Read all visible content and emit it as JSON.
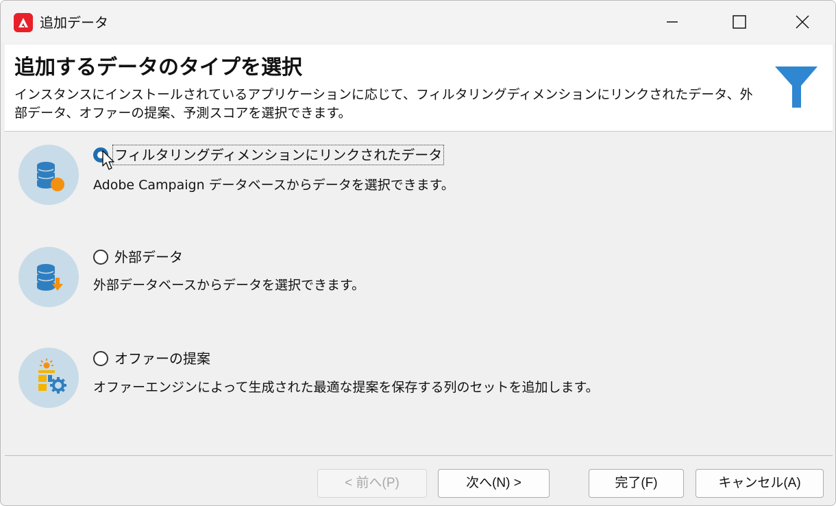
{
  "window": {
    "title": "追加データ"
  },
  "header": {
    "title": "追加するデータのタイプを選択",
    "description": "インスタンスにインストールされているアプリケーションに応じて、フィルタリングディメンションにリンクされたデータ、外部データ、オファーの提案、予測スコアを選択できます。"
  },
  "options": [
    {
      "label": "フィルタリングディメンションにリンクされたデータ",
      "description": "Adobe Campaign データベースからデータを選択できます。",
      "selected": true,
      "icon": "database-linked-icon"
    },
    {
      "label": "外部データ",
      "description": "外部データベースからデータを選択できます。",
      "selected": false,
      "icon": "database-download-icon"
    },
    {
      "label": "オファーの提案",
      "description": "オファーエンジンによって生成された最適な提案を保存する列のセットを追加します。",
      "selected": false,
      "icon": "offer-gear-icon"
    }
  ],
  "buttons": {
    "prev": "< 前へ(P)",
    "next": "次へ(N) >",
    "finish": "完了(F)",
    "cancel": "キャンセル(A)"
  },
  "colors": {
    "accent": "#1f6fb0",
    "icon_blue": "#2f7fc0",
    "icon_orange": "#f29111",
    "icon_bg": "#c8dbe8",
    "funnel": "#2f86d1",
    "brand_red": "#e8202a"
  }
}
